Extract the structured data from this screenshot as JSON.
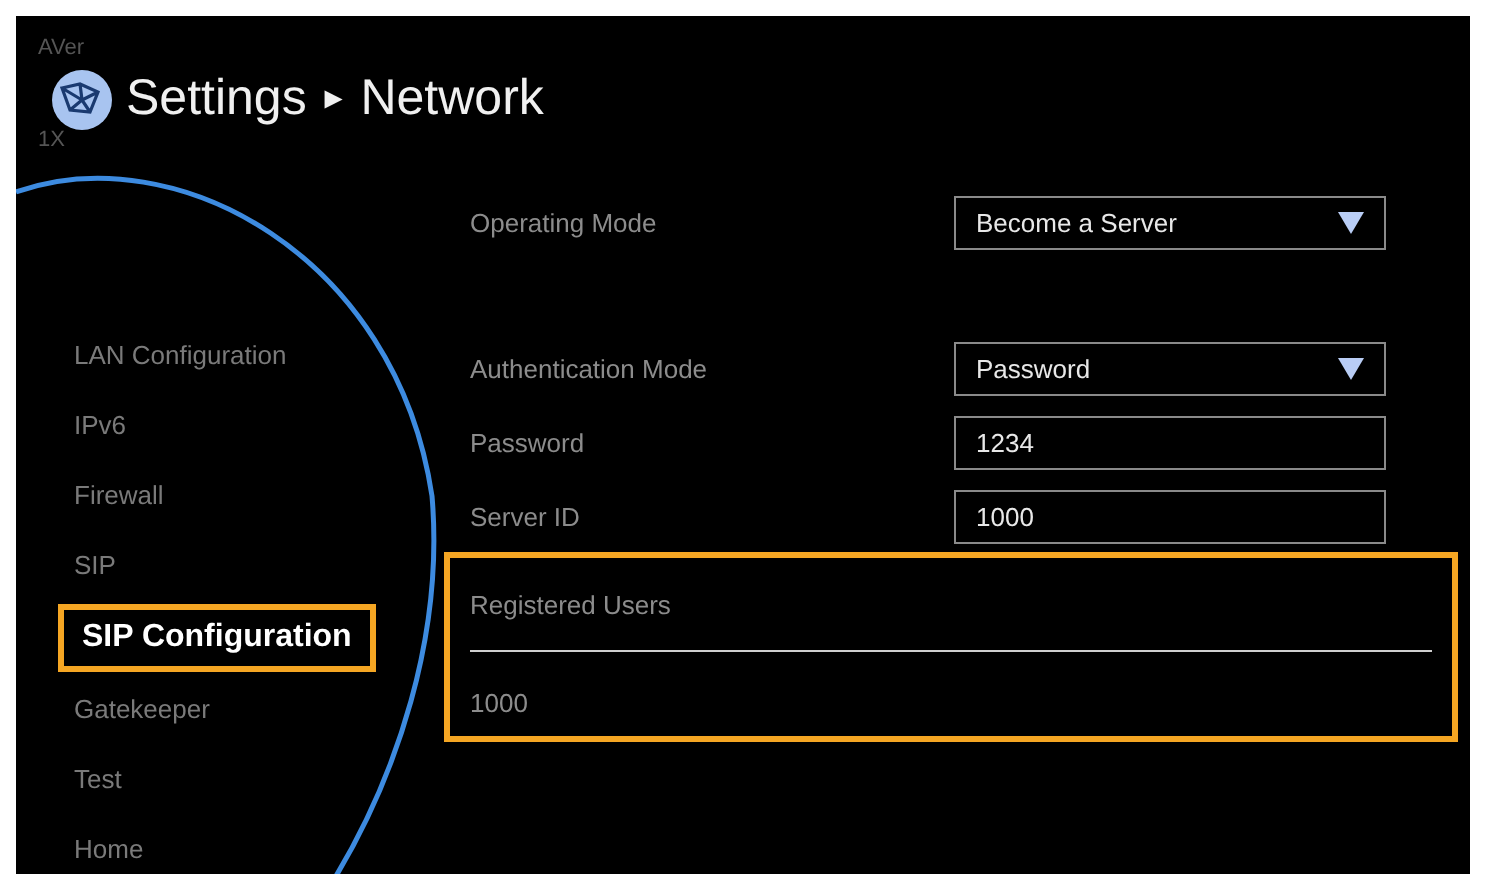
{
  "header": {
    "brand": "AVer",
    "zoom": "1X",
    "title": "Settings",
    "separator": "►",
    "page": "Network"
  },
  "sidebar": {
    "items": [
      {
        "label": "LAN Configuration",
        "selected": false
      },
      {
        "label": "IPv6",
        "selected": false
      },
      {
        "label": "Firewall",
        "selected": false
      },
      {
        "label": "SIP",
        "selected": false
      },
      {
        "label": "SIP Configuration",
        "selected": true
      },
      {
        "label": "Gatekeeper",
        "selected": false
      },
      {
        "label": "Test",
        "selected": false
      },
      {
        "label": "Home",
        "selected": false
      }
    ]
  },
  "form": {
    "fields": [
      {
        "label": "Operating Mode",
        "kind": "select",
        "value": "Become a Server"
      },
      {
        "label": "Authentication Mode",
        "kind": "select",
        "value": "Password"
      },
      {
        "label": "Password",
        "kind": "text",
        "value": "1234"
      },
      {
        "label": "Server ID",
        "kind": "text",
        "value": "1000"
      }
    ]
  },
  "registered_users": {
    "title": "Registered Users",
    "highlighted": true,
    "users": [
      "1000"
    ]
  }
}
